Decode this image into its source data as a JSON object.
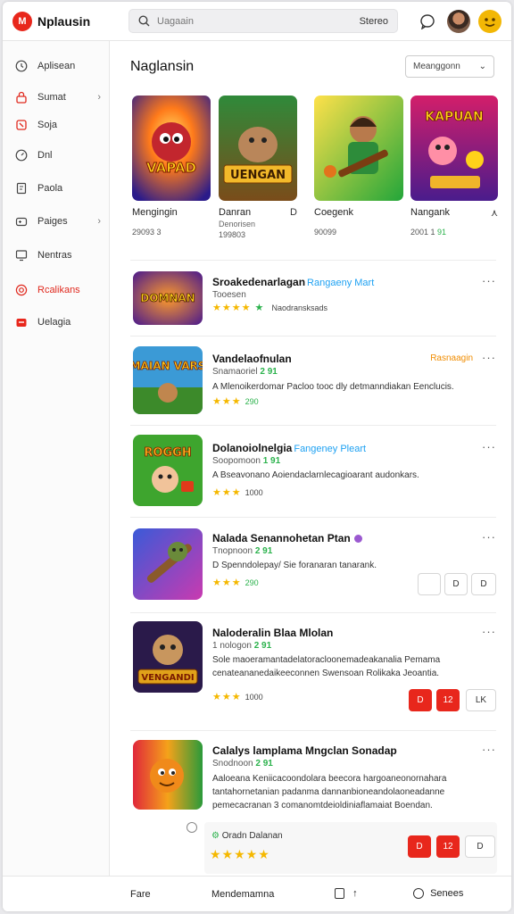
{
  "header": {
    "logo_text": "Nplausin",
    "search_placeholder": "Uagaain",
    "search_button": "Stereo"
  },
  "sidebar": {
    "items": [
      {
        "label": "Aplisean",
        "icon": "clock-icon",
        "highlight": false
      },
      {
        "label": "Sumat",
        "icon": "lock-icon",
        "highlight": true
      },
      {
        "label": "Soja",
        "icon": "tag-icon",
        "highlight": false
      },
      {
        "label": "Dnl",
        "icon": "gauge-icon",
        "highlight": false
      },
      {
        "label": "Paola",
        "icon": "document-icon",
        "highlight": false
      },
      {
        "label": "Paiges",
        "icon": "gamepad-icon",
        "highlight": false,
        "chevron": "›"
      },
      {
        "label": "Nentras",
        "icon": "monitor-icon",
        "highlight": false
      },
      {
        "label": "Rcalikans",
        "icon": "target-icon",
        "highlight": true
      },
      {
        "label": "Uelagia",
        "icon": "gift-icon",
        "highlight": false
      }
    ]
  },
  "main": {
    "title": "Naglansin",
    "sort_label": "Meanggonn",
    "sort_chevron": "⌄",
    "featured": [
      {
        "name": "Mengingin",
        "sub": "",
        "meta": "29093 3",
        "action": "",
        "art_text": "VAPAD"
      },
      {
        "name": "Danran",
        "sub": "Denorisen",
        "meta": "199803",
        "action": "D",
        "art_text": "UENGAN"
      },
      {
        "name": "Coegenk",
        "sub": "",
        "meta": "90099",
        "action": "",
        "art_text": ""
      },
      {
        "name": "Nangank",
        "sub": "",
        "meta": "2001 1",
        "meta_green": "91",
        "action": "⋏",
        "art_text": "KAPUAN"
      }
    ],
    "rows": [
      {
        "title": "Sroakedenarlagan",
        "tag": "Rangaeny Mart",
        "sub": "Tooesen",
        "desc": "",
        "stars": "★★★★",
        "rating_text": "Naodransksads",
        "art_text": "DOMNAN",
        "buttons": []
      },
      {
        "title": "Vandelaofnulan",
        "tag": "Rasnaagin",
        "sub": "Snamaoriel",
        "sub_green": "2 91",
        "desc": "A  Mlenoikerdomar  Pacloo  tooc dly detmanndiakan  Eenclucis.",
        "stars": "★★★",
        "rating_text": "290",
        "art_text": "MAIAN VARS",
        "buttons": []
      },
      {
        "title": "Dolanoiolnelgia",
        "tag": "Fangeney Pleart",
        "sub": "Soopomoon",
        "sub_green": "1 91",
        "desc": "A  Bseavonano  Aoiendaclarnlecagioarant audonkars.",
        "stars": "★★★",
        "rating_text": "1000",
        "art_text": "ROGGH",
        "buttons": []
      },
      {
        "title": "Nalada Senannohetan Ptan",
        "tag": "",
        "sub": "Tnopnoon",
        "sub_green": "2 91",
        "desc": "D  Spenndolepay/ Sie foranaran tanarank.",
        "stars": "★★★",
        "rating_text": "290",
        "art_text": "",
        "buttons": [
          "",
          "D",
          "D"
        ]
      },
      {
        "title": "Naloderalin Blaa Mlolan",
        "tag": "",
        "sub": "1 nologon",
        "sub_green": "2 91",
        "desc": "Sole maoeramantadelatoracloonemadeakanalia Pemama cenateananedaikeeconnen Swensoan  Rolikaka Jeoantia.",
        "stars": "★★★",
        "rating_text": "1000",
        "art_text": "VENGANDI",
        "buttons": [
          "D",
          "12",
          "LK"
        ]
      },
      {
        "title": "Calalys lamplama  Mngclan Sonadap",
        "tag": "",
        "sub": "Snodnoon",
        "sub_green": "2 91",
        "desc": "Aaloeana  Keniicacoondolara  beecora  hargoaneonornahara tantahornetanian padanma dannanbioneandolaoneadanne pemecacranan 3 comanomtdeioldiniaflamaiat  Boendan.",
        "stars": "★★★★★",
        "rating_text": "Oradn Dalanan",
        "art_text": "",
        "buttons": [
          "D",
          "12",
          "D"
        ]
      }
    ]
  },
  "bottom_bar": {
    "item1": "Fare",
    "item2": "Mendemamna",
    "item3_arrow": "↑",
    "item4": "Senees"
  },
  "colors": {
    "accent": "#e8271c",
    "link": "#1ea1f2",
    "star": "#f5b800",
    "green": "#2bb24c"
  }
}
